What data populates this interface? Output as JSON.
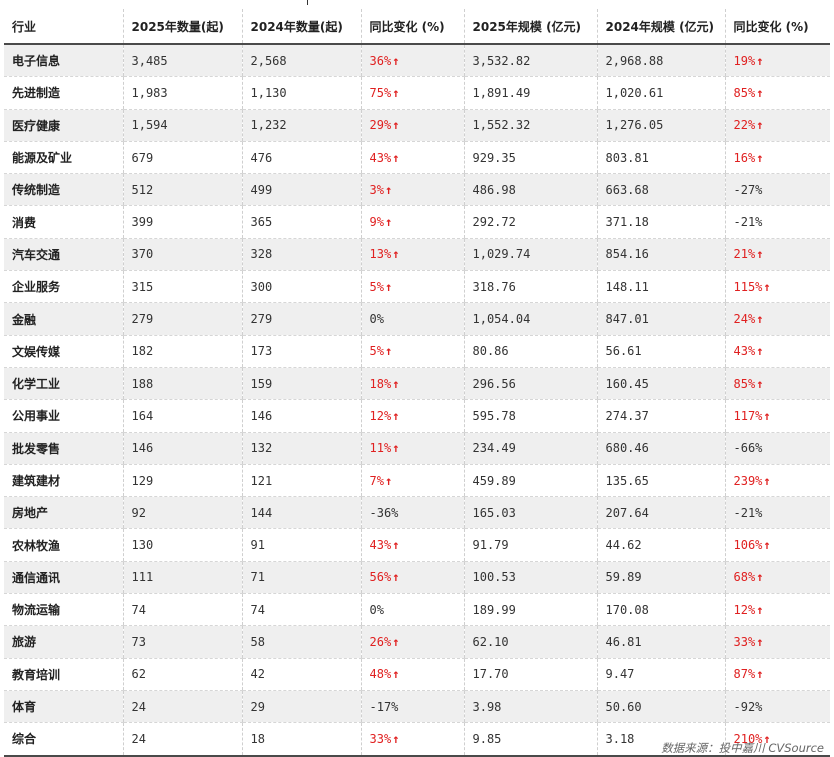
{
  "headers": [
    "行业",
    "2025年数量(起)",
    "2024年数量(起)",
    "同比变化 (%)",
    "2025年规模 (亿元)",
    "2024年规模 (亿元)",
    "同比变化 (%)"
  ],
  "rows": [
    {
      "industry": "电子信息",
      "count2025": "3,485",
      "count2024": "2,568",
      "count_change": "36%",
      "count_up": true,
      "scale2025": "3,532.82",
      "scale2024": "2,968.88",
      "scale_change": "19%",
      "scale_up": true
    },
    {
      "industry": "先进制造",
      "count2025": "1,983",
      "count2024": "1,130",
      "count_change": "75%",
      "count_up": true,
      "scale2025": "1,891.49",
      "scale2024": "1,020.61",
      "scale_change": "85%",
      "scale_up": true
    },
    {
      "industry": "医疗健康",
      "count2025": "1,594",
      "count2024": "1,232",
      "count_change": "29%",
      "count_up": true,
      "scale2025": "1,552.32",
      "scale2024": "1,276.05",
      "scale_change": "22%",
      "scale_up": true
    },
    {
      "industry": "能源及矿业",
      "count2025": "679",
      "count2024": "476",
      "count_change": "43%",
      "count_up": true,
      "scale2025": "929.35",
      "scale2024": "803.81",
      "scale_change": "16%",
      "scale_up": true
    },
    {
      "industry": "传统制造",
      "count2025": "512",
      "count2024": "499",
      "count_change": "3%",
      "count_up": true,
      "scale2025": "486.98",
      "scale2024": "663.68",
      "scale_change": "-27%",
      "scale_up": false
    },
    {
      "industry": "消费",
      "count2025": "399",
      "count2024": "365",
      "count_change": "9%",
      "count_up": true,
      "scale2025": "292.72",
      "scale2024": "371.18",
      "scale_change": "-21%",
      "scale_up": false
    },
    {
      "industry": "汽车交通",
      "count2025": "370",
      "count2024": "328",
      "count_change": "13%",
      "count_up": true,
      "scale2025": "1,029.74",
      "scale2024": "854.16",
      "scale_change": "21%",
      "scale_up": true
    },
    {
      "industry": "企业服务",
      "count2025": "315",
      "count2024": "300",
      "count_change": "5%",
      "count_up": true,
      "scale2025": "318.76",
      "scale2024": "148.11",
      "scale_change": "115%",
      "scale_up": true
    },
    {
      "industry": "金融",
      "count2025": "279",
      "count2024": "279",
      "count_change": "0%",
      "count_up": false,
      "scale2025": "1,054.04",
      "scale2024": "847.01",
      "scale_change": "24%",
      "scale_up": true
    },
    {
      "industry": "文娱传媒",
      "count2025": "182",
      "count2024": "173",
      "count_change": "5%",
      "count_up": true,
      "scale2025": "80.86",
      "scale2024": "56.61",
      "scale_change": "43%",
      "scale_up": true
    },
    {
      "industry": "化学工业",
      "count2025": "188",
      "count2024": "159",
      "count_change": "18%",
      "count_up": true,
      "scale2025": "296.56",
      "scale2024": "160.45",
      "scale_change": "85%",
      "scale_up": true
    },
    {
      "industry": "公用事业",
      "count2025": "164",
      "count2024": "146",
      "count_change": "12%",
      "count_up": true,
      "scale2025": "595.78",
      "scale2024": "274.37",
      "scale_change": "117%",
      "scale_up": true
    },
    {
      "industry": "批发零售",
      "count2025": "146",
      "count2024": "132",
      "count_change": "11%",
      "count_up": true,
      "scale2025": "234.49",
      "scale2024": "680.46",
      "scale_change": "-66%",
      "scale_up": false
    },
    {
      "industry": "建筑建材",
      "count2025": "129",
      "count2024": "121",
      "count_change": "7%",
      "count_up": true,
      "scale2025": "459.89",
      "scale2024": "135.65",
      "scale_change": "239%",
      "scale_up": true
    },
    {
      "industry": "房地产",
      "count2025": "92",
      "count2024": "144",
      "count_change": "-36%",
      "count_up": false,
      "scale2025": "165.03",
      "scale2024": "207.64",
      "scale_change": "-21%",
      "scale_up": false
    },
    {
      "industry": "农林牧渔",
      "count2025": "130",
      "count2024": "91",
      "count_change": "43%",
      "count_up": true,
      "scale2025": "91.79",
      "scale2024": "44.62",
      "scale_change": "106%",
      "scale_up": true
    },
    {
      "industry": "通信通讯",
      "count2025": "111",
      "count2024": "71",
      "count_change": "56%",
      "count_up": true,
      "scale2025": "100.53",
      "scale2024": "59.89",
      "scale_change": "68%",
      "scale_up": true
    },
    {
      "industry": "物流运输",
      "count2025": "74",
      "count2024": "74",
      "count_change": "0%",
      "count_up": false,
      "scale2025": "189.99",
      "scale2024": "170.08",
      "scale_change": "12%",
      "scale_up": true
    },
    {
      "industry": "旅游",
      "count2025": "73",
      "count2024": "58",
      "count_change": "26%",
      "count_up": true,
      "scale2025": "62.10",
      "scale2024": "46.81",
      "scale_change": "33%",
      "scale_up": true
    },
    {
      "industry": "教育培训",
      "count2025": "62",
      "count2024": "42",
      "count_change": "48%",
      "count_up": true,
      "scale2025": "17.70",
      "scale2024": "9.47",
      "scale_change": "87%",
      "scale_up": true
    },
    {
      "industry": "体育",
      "count2025": "24",
      "count2024": "29",
      "count_change": "-17%",
      "count_up": false,
      "scale2025": "3.98",
      "scale2024": "50.60",
      "scale_change": "-92%",
      "scale_up": false
    },
    {
      "industry": "综合",
      "count2025": "24",
      "count2024": "18",
      "count_change": "33%",
      "count_up": true,
      "scale2025": "9.85",
      "scale2024": "3.18",
      "scale_change": "210%",
      "scale_up": true
    }
  ],
  "up_arrow_icon": "arrow-up-icon",
  "up_color": "#e02020",
  "source": "数据来源：投中嘉川 CVSource"
}
